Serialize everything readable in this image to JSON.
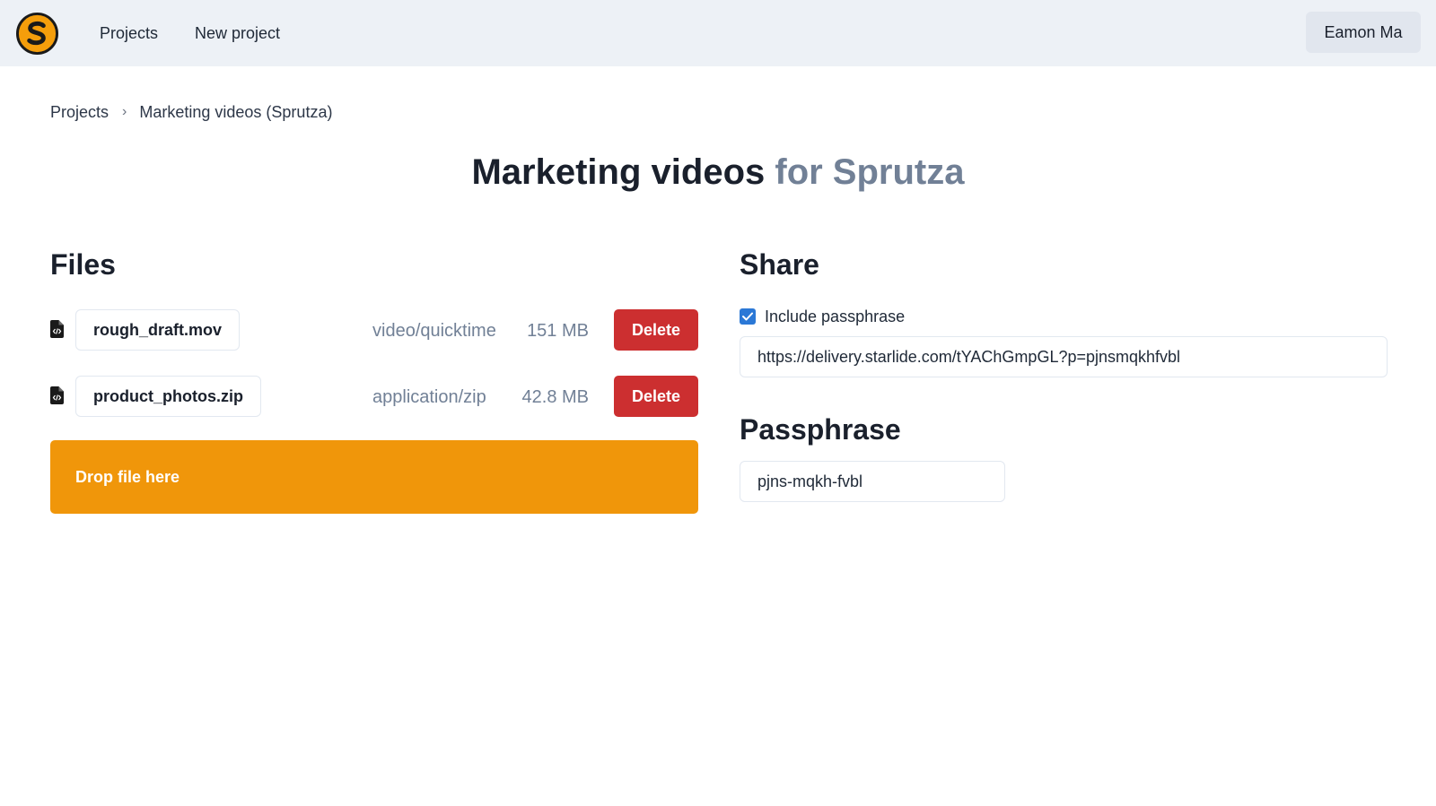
{
  "nav": {
    "logo_name": "sprutza-logo",
    "links": [
      "Projects",
      "New project"
    ],
    "user": "Eamon Ma"
  },
  "breadcrumb": {
    "root": "Projects",
    "separator": "›",
    "current": "Marketing videos (Sprutza)"
  },
  "title": {
    "main": "Marketing videos",
    "muted": "for Sprutza"
  },
  "files": {
    "heading": "Files",
    "items": [
      {
        "name": "rough_draft.mov",
        "type": "video/quicktime",
        "size": "151 MB",
        "delete_label": "Delete"
      },
      {
        "name": "product_photos.zip",
        "type": "application/zip",
        "size": "42.8 MB",
        "delete_label": "Delete"
      }
    ],
    "dropzone_label": "Drop file here"
  },
  "share": {
    "heading": "Share",
    "checkbox_label": "Include passphrase",
    "checkbox_checked": true,
    "url": "https://delivery.starlide.com/tYAChGmpGL?p=pjnsmqkhfvbl"
  },
  "passphrase": {
    "heading": "Passphrase",
    "value": "pjns-mqkh-fvbl"
  },
  "colors": {
    "topbar": "#edf1f6",
    "accent_orange": "#f0960a",
    "delete_red": "#cc2f30",
    "checkbox_blue": "#2b78d6",
    "muted_text": "#718096"
  }
}
